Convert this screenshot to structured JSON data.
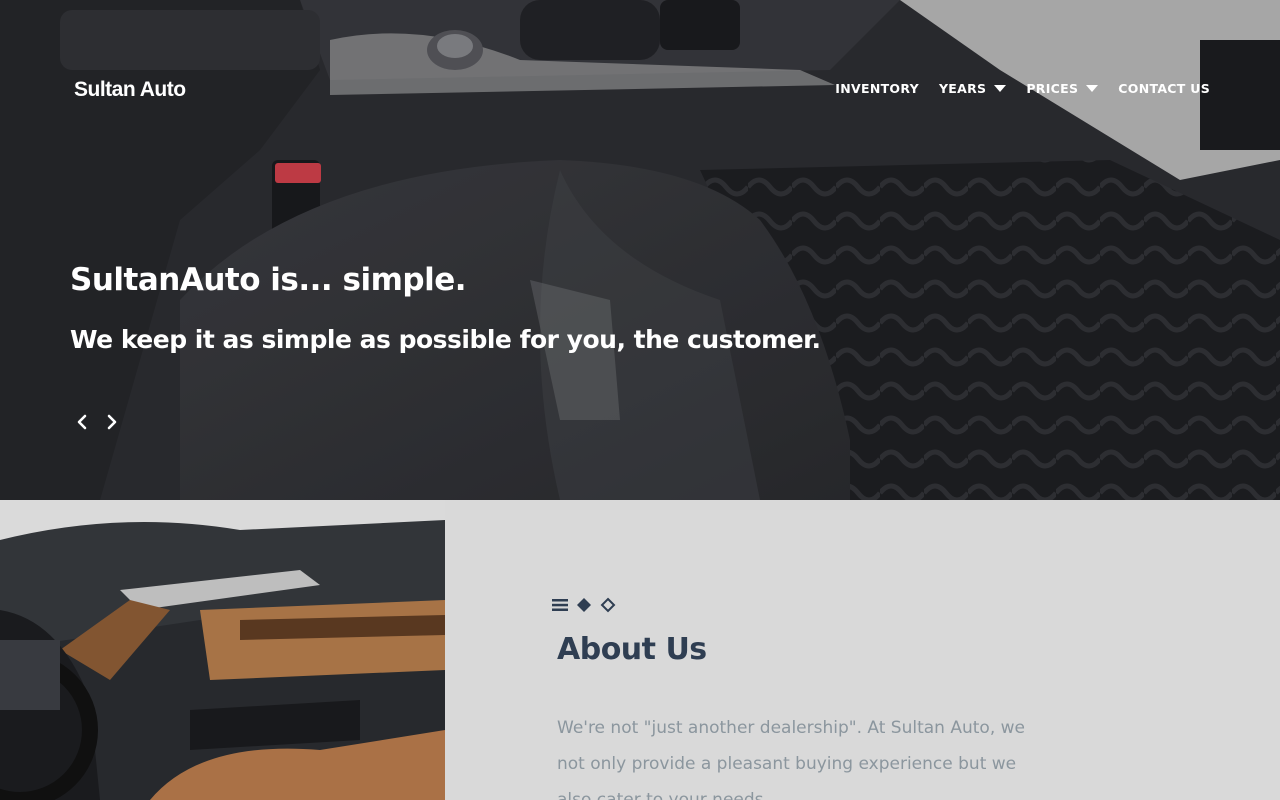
{
  "header": {
    "logo": "Sultan Auto",
    "nav": [
      {
        "label": "INVENTORY",
        "has_dropdown": false
      },
      {
        "label": "YEARS",
        "has_dropdown": true
      },
      {
        "label": "PRICES",
        "has_dropdown": true
      },
      {
        "label": "CONTACT US",
        "has_dropdown": false
      }
    ]
  },
  "hero": {
    "title": "SultanAuto is... simple.",
    "subtitle": "We keep it as simple as possible for you, the customer.",
    "prev_icon": "chevron-left-icon",
    "next_icon": "chevron-right-icon"
  },
  "about": {
    "ornament_icons": [
      "menu-icon",
      "diamond-filled-icon",
      "diamond-outline-icon"
    ],
    "title": "About Us",
    "text": "We're not \"just another dealership\". At Sultan Auto, we not only provide a pleasant buying experience but we also cater to your needs."
  },
  "colors": {
    "heading": "#2f3e52",
    "body_text": "#8b969e",
    "about_bg": "#d9d9d9",
    "hero_text": "#ffffff"
  }
}
